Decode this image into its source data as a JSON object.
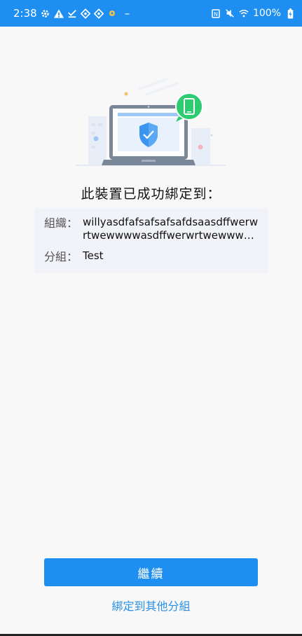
{
  "status_bar": {
    "time": "2:38",
    "battery": "100%",
    "minus": "–"
  },
  "main": {
    "title": "此裝置已成功綁定到：",
    "org_label": "組織：",
    "org_value": "willyasdfafsafsafsafdsaasdffwerwrtwewwwwasdffwerwrtwewwwwasdffwerwrtwe",
    "group_label": "分組：",
    "group_value": "Test"
  },
  "actions": {
    "continue_label": "繼續",
    "bind_other_label": "綁定到其他分組"
  },
  "colors": {
    "accent": "#1e8ff0",
    "success": "#2ecc71"
  }
}
